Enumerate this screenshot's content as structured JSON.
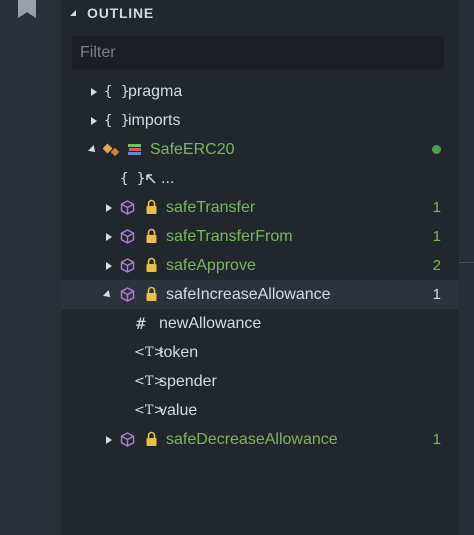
{
  "header": {
    "title": "OUTLINE"
  },
  "filter": {
    "placeholder": "Filter"
  },
  "tree": {
    "pragma": {
      "label": "pragma",
      "icon": "braces-icon"
    },
    "imports": {
      "label": "imports",
      "icon": "braces-icon"
    },
    "contract": {
      "label": "SafeERC20",
      "icon": "library-icon"
    },
    "anon": {
      "label": "...",
      "icon": "braces-icon"
    },
    "f1": {
      "label": "safeTransfer",
      "count": "1"
    },
    "f2": {
      "label": "safeTransferFrom",
      "count": "1"
    },
    "f3": {
      "label": "safeApprove",
      "count": "2"
    },
    "f4": {
      "label": "safeIncreaseAllowance",
      "count": "1"
    },
    "v1": {
      "label": "newAllowance"
    },
    "p1": {
      "label": "token"
    },
    "p2": {
      "label": "spender"
    },
    "p3": {
      "label": "value"
    },
    "f5": {
      "label": "safeDecreaseAllowance",
      "count": "1"
    }
  },
  "colors": {
    "accent_green": "#7bb661",
    "method_purple": "#b07ed6",
    "lock_gold": "#e6c04a",
    "dot_green": "#4f9a55"
  }
}
